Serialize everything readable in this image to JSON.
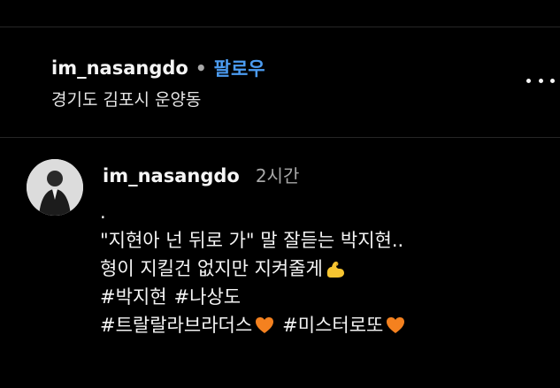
{
  "post_header": {
    "username": "im_nasangdo",
    "separator": "•",
    "follow_label": "팔로우",
    "location": "경기도 김포시 운양동"
  },
  "caption": {
    "username": "im_nasangdo",
    "time": "2시간",
    "lines": [
      ".",
      "\"지현아 넌 뒤로 가\" 말 잘듣는 박지현..",
      "형이 지킬건 없지만 지켜줄게"
    ],
    "hashtags_line1": [
      "#박지현",
      "#나상도"
    ],
    "hashtags_line2": [
      "#트랄랄라브라더스",
      "#미스터로또"
    ]
  },
  "icons": {
    "more": "more-options-icon",
    "flexed_biceps": "flexed-biceps-emoji-icon",
    "heart": "orange-heart-emoji-icon"
  },
  "colors": {
    "background": "#000000",
    "text": "#f5f5f5",
    "secondary": "#a8a8a8",
    "link_blue": "#4c9cf1",
    "divider": "#262626",
    "heart_orange": "#f4811f",
    "biceps_yellow": "#f7c531"
  }
}
